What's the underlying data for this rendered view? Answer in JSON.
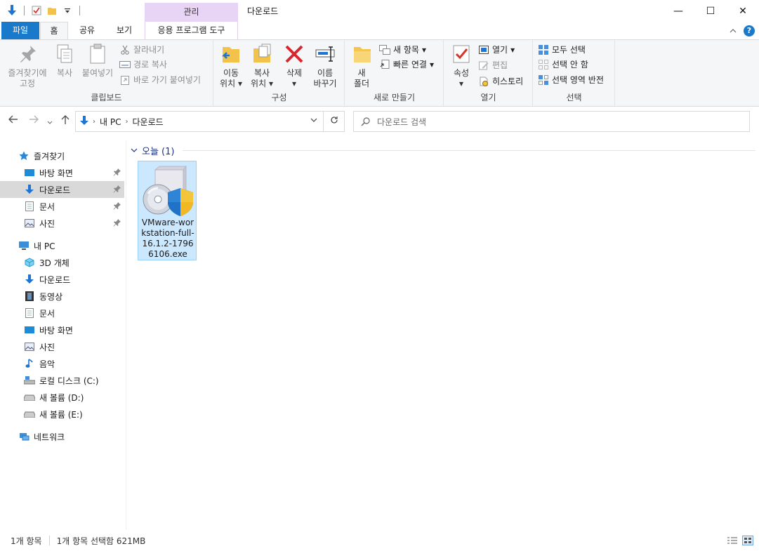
{
  "titlebar": {
    "context_group": "관리",
    "window_title": "다운로드",
    "minimize": "—",
    "maximize": "☐",
    "close": "✕"
  },
  "tabs": {
    "file": "파일",
    "home": "홈",
    "share": "공유",
    "view": "보기",
    "app_tools": "응용 프로그램 도구",
    "help": "?"
  },
  "ribbon": {
    "clipboard": {
      "pin_line1": "즐겨찾기에",
      "pin_line2": "고정",
      "copy": "복사",
      "paste": "붙여넣기",
      "cut": "잘라내기",
      "copy_path": "경로 복사",
      "paste_shortcut": "바로 가기 붙여넣기",
      "label": "클립보드"
    },
    "organize": {
      "move_line1": "이동",
      "move_line2": "위치",
      "copyto_line1": "복사",
      "copyto_line2": "위치",
      "delete": "삭제",
      "rename_line1": "이름",
      "rename_line2": "바꾸기",
      "label": "구성"
    },
    "new": {
      "folder_line1": "새",
      "folder_line2": "폴더",
      "new_item": "새 항목",
      "easy_access": "빠른 연결",
      "label": "새로 만들기"
    },
    "open": {
      "properties": "속성",
      "open": "열기",
      "edit": "편집",
      "history": "히스토리",
      "label": "열기"
    },
    "select": {
      "select_all": "모두 선택",
      "select_none": "선택 안 함",
      "invert": "선택 영역 반전",
      "label": "선택"
    }
  },
  "address": {
    "crumbs": [
      "내 PC",
      "다운로드"
    ],
    "search_placeholder": "다운로드 검색"
  },
  "nav": {
    "quick_access": "즐겨찾기",
    "qa_items": [
      "바탕 화면",
      "다운로드",
      "문서",
      "사진"
    ],
    "this_pc": "내 PC",
    "pc_items": [
      "3D 개체",
      "다운로드",
      "동영상",
      "문서",
      "바탕 화면",
      "사진",
      "음악",
      "로컬 디스크 (C:)",
      "새 볼륨 (D:)",
      "새 볼륨 (E:)"
    ],
    "network": "네트워크"
  },
  "content": {
    "group_label": "오늘 (1)",
    "file_name": "VMware-workstation-full-16.1.2-17966106.exe"
  },
  "status": {
    "item_count": "1개 항목",
    "selection": "1개 항목 선택함 621MB"
  },
  "colors": {
    "accent": "#1979ca",
    "selection_bg": "#cce8ff",
    "selection_border": "#99d1ff",
    "context_tab": "#e8d5f5"
  }
}
